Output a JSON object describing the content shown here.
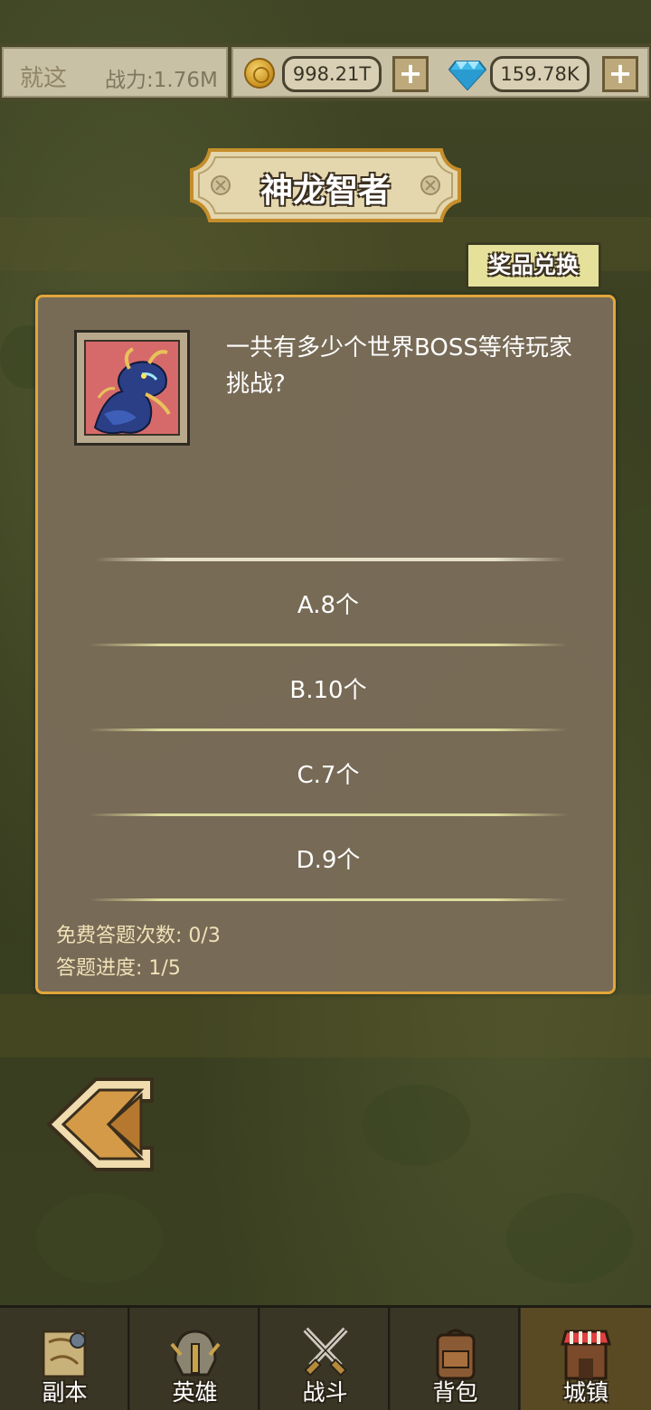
{
  "topbar": {
    "player_name": "就这",
    "power": "战力:1.76M",
    "gold": "998.21T",
    "gems": "159.78K",
    "gold_plus": "+",
    "gems_plus": "+"
  },
  "dialog": {
    "title": "神龙智者",
    "exchange_label": "奖品兑换",
    "question": "一共有多少个世界BOSS等待玩家挑战?",
    "options": [
      {
        "label": "A.8个"
      },
      {
        "label": "B.10个"
      },
      {
        "label": "C.7个"
      },
      {
        "label": "D.9个"
      }
    ],
    "free_attempts": "免费答题次数: 0/3",
    "progress": "答题进度: 1/5"
  },
  "nav": {
    "items": [
      {
        "label": "副本",
        "icon": "map-scroll-icon"
      },
      {
        "label": "英雄",
        "icon": "helmet-icon"
      },
      {
        "label": "战斗",
        "icon": "crossed-swords-icon"
      },
      {
        "label": "背包",
        "icon": "backpack-icon"
      },
      {
        "label": "城镇",
        "icon": "shop-building-icon"
      }
    ],
    "active_index": 4
  },
  "colors": {
    "panel_border": "#e2a63a",
    "panel_bg": "#7a6c58",
    "exchange_bg": "#e6e19a"
  }
}
